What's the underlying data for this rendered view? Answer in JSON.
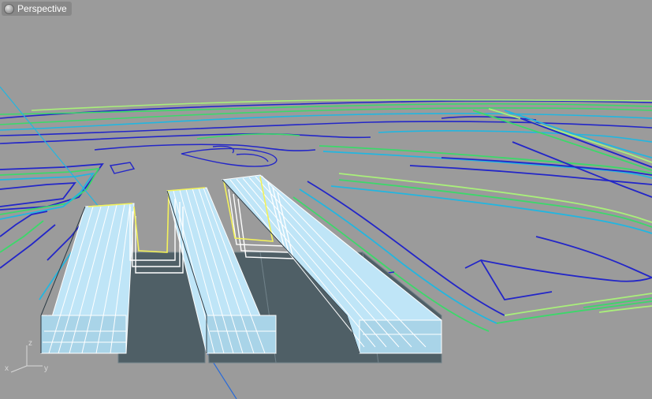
{
  "viewport": {
    "title": "Perspective",
    "background_color": "#9b9b9b",
    "display_mode": "wireframe"
  },
  "axes": {
    "z_label": "z",
    "x_label": "x",
    "y_label": "y"
  },
  "colors": {
    "contour_blue": "#2326c8",
    "contour_cyan": "#22b6e0",
    "contour_green": "#3cd86a",
    "contour_lime": "#a9f07a",
    "selection_yellow": "#f3f25a",
    "pier_fill": "#bfe5f7",
    "pier_shadow": "#4f5f66"
  }
}
